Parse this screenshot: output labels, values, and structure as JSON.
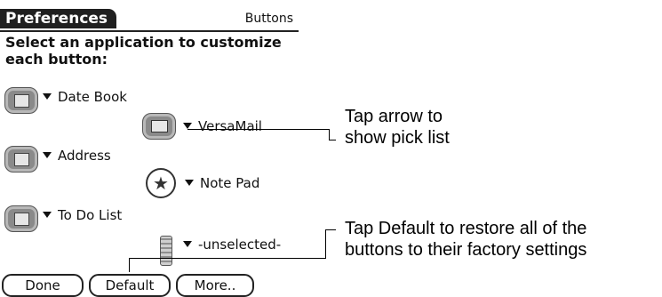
{
  "app": {
    "title": "Preferences",
    "category": "Buttons",
    "instruction": "Select an application to customize each button:"
  },
  "rows": [
    {
      "hardware_icon": "datebook-button-icon",
      "label": "Date Book"
    },
    {
      "hardware_icon": "address-button-icon",
      "label": "Address"
    },
    {
      "hardware_icon": "todo-button-icon",
      "label": "To Do List"
    }
  ],
  "assignments": [
    {
      "app_icon": "versamail-icon",
      "label": "VersaMail"
    },
    {
      "app_icon": "note-pad-icon",
      "label": "Note Pad"
    },
    {
      "app_icon": "unselected-icon",
      "label": "-unselected-"
    }
  ],
  "buttons": {
    "done": "Done",
    "default": "Default",
    "more": "More.."
  },
  "callouts": {
    "arrow_line1": "Tap arrow to",
    "arrow_line2": "show pick list",
    "default_line1": "Tap Default to restore all of the",
    "default_line2": "buttons to their factory settings"
  }
}
